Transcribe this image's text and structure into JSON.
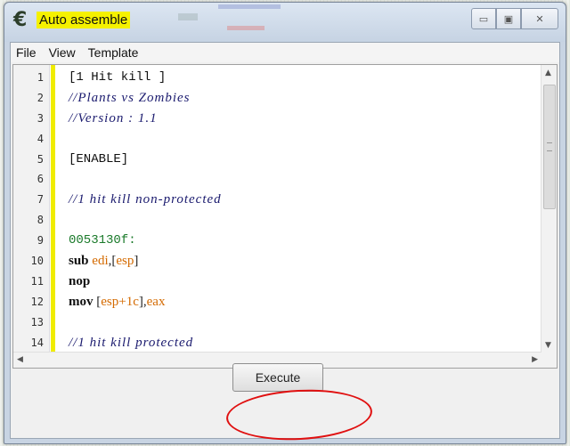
{
  "window": {
    "title": "Auto assemble",
    "app_icon": "cheat-engine-icon",
    "controls": {
      "minimize": "▭",
      "maximize": "▣",
      "close": "✕"
    }
  },
  "menu": {
    "items": [
      "File",
      "View",
      "Template"
    ]
  },
  "editor": {
    "lines": [
      {
        "n": "1",
        "type": "plain",
        "text": "[1 Hit kill ]"
      },
      {
        "n": "2",
        "type": "comment",
        "text": "//Plants vs Zombies"
      },
      {
        "n": "3",
        "type": "comment",
        "text": "//Version : 1.1"
      },
      {
        "n": "4",
        "type": "plain",
        "text": ""
      },
      {
        "n": "5",
        "type": "plain",
        "text": "[ENABLE]"
      },
      {
        "n": "6",
        "type": "plain",
        "text": ""
      },
      {
        "n": "7",
        "type": "comment",
        "text": "//1 hit kill non-protected"
      },
      {
        "n": "8",
        "type": "plain",
        "text": ""
      },
      {
        "n": "9",
        "type": "addr",
        "text": "0053130f:"
      },
      {
        "n": "10",
        "type": "asm",
        "op": "sub ",
        "args": "edi,[esp]"
      },
      {
        "n": "11",
        "type": "asm",
        "op": "nop",
        "args": ""
      },
      {
        "n": "12",
        "type": "asm",
        "op": "mov ",
        "args": "[esp+1c],eax"
      },
      {
        "n": "13",
        "type": "plain",
        "text": ""
      },
      {
        "n": "14",
        "type": "comment",
        "text": "//1 hit kill protected"
      }
    ]
  },
  "footer": {
    "execute_label": "Execute"
  },
  "colors": {
    "title_highlight": "#f5f100",
    "annotation_circle": "#e01010"
  }
}
